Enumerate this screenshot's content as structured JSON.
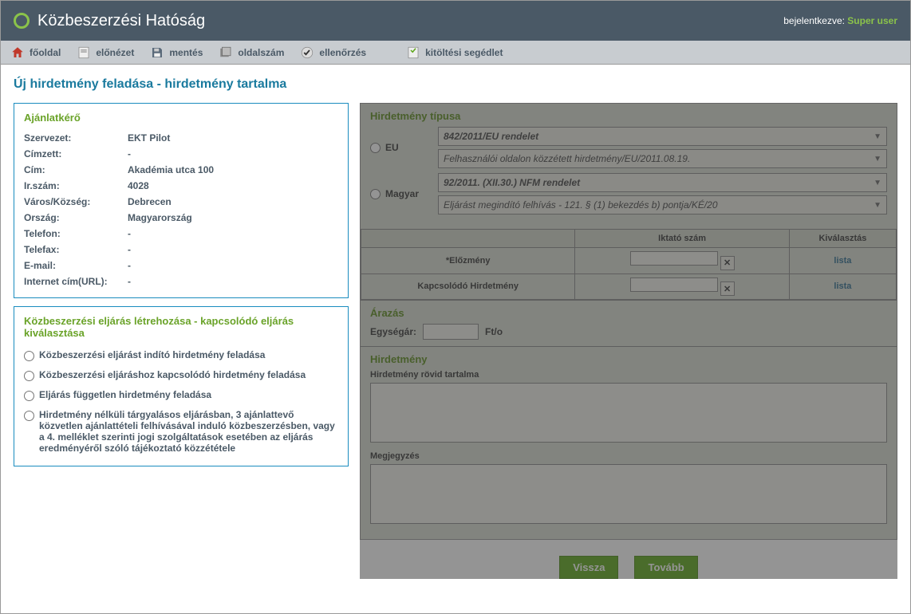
{
  "header": {
    "title": "Közbeszerzési Hatóság",
    "login_label": "bejelentkezve:",
    "user": "Super user"
  },
  "toolbar": {
    "home": "főoldal",
    "preview": "előnézet",
    "save": "mentés",
    "pagecount": "oldalszám",
    "check": "ellenőrzés",
    "help": "kitöltési segédlet"
  },
  "page_title": "Új hirdetmény feladása - hirdetmény tartalma",
  "requester": {
    "panel_title": "Ajánlatkérő",
    "rows": [
      {
        "label": "Szervezet:",
        "value": "EKT Pilot"
      },
      {
        "label": "Címzett:",
        "value": "-"
      },
      {
        "label": "Cím:",
        "value": "Akadémia utca 100"
      },
      {
        "label": "Ir.szám:",
        "value": "4028"
      },
      {
        "label": "Város/Község:",
        "value": "Debrecen"
      },
      {
        "label": "Ország:",
        "value": "Magyarország"
      },
      {
        "label": "Telefon:",
        "value": "-"
      },
      {
        "label": "Telefax:",
        "value": "-"
      },
      {
        "label": "E-mail:",
        "value": "-"
      },
      {
        "label": "Internet cím(URL):",
        "value": "-"
      }
    ]
  },
  "procedure": {
    "panel_title": "Közbeszerzési eljárás létrehozása - kapcsolódó eljárás kiválasztása",
    "options": [
      "Közbeszerzési eljárást indító hirdetmény feladása",
      "Közbeszerzési eljáráshoz kapcsolódó hirdetmény feladása",
      "Eljárás független hirdetmény feladása",
      "Hirdetmény nélküli tárgyalásos eljárásban, 3 ajánlattevő közvetlen ajánlattételi felhívásával induló közbeszerzésben, vagy a 4. melléklet szerinti jogi szolgáltatások esetében az eljárás eredményéről szóló tájékoztató közzététele"
    ]
  },
  "notice_type": {
    "panel_title": "Hirdetmény típusa",
    "eu_label": "EU",
    "eu_sel1": "842/2011/EU rendelet",
    "eu_sel2": "Felhasználói oldalon közzétett hirdetmény/EU/2011.08.19.",
    "hu_label": "Magyar",
    "hu_sel1": "92/2011. (XII.30.) NFM rendelet",
    "hu_sel2": "Eljárást megindító felhívás - 121. § (1) bekezdés b) pontja/KÉ/20"
  },
  "link_table": {
    "col_iktato": "Iktató szám",
    "col_select": "Kiválasztás",
    "row1_label": "*Előzmény",
    "row2_label": "Kapcsolódó Hirdetmény",
    "list_link": "lista"
  },
  "pricing": {
    "panel_title": "Árazás",
    "label": "Egységár:",
    "unit": "Ft/o"
  },
  "notice": {
    "panel_title": "Hirdetmény",
    "content_label": "Hirdetmény rövid tartalma",
    "note_label": "Megjegyzés"
  },
  "buttons": {
    "back": "Vissza",
    "next": "Tovább"
  }
}
